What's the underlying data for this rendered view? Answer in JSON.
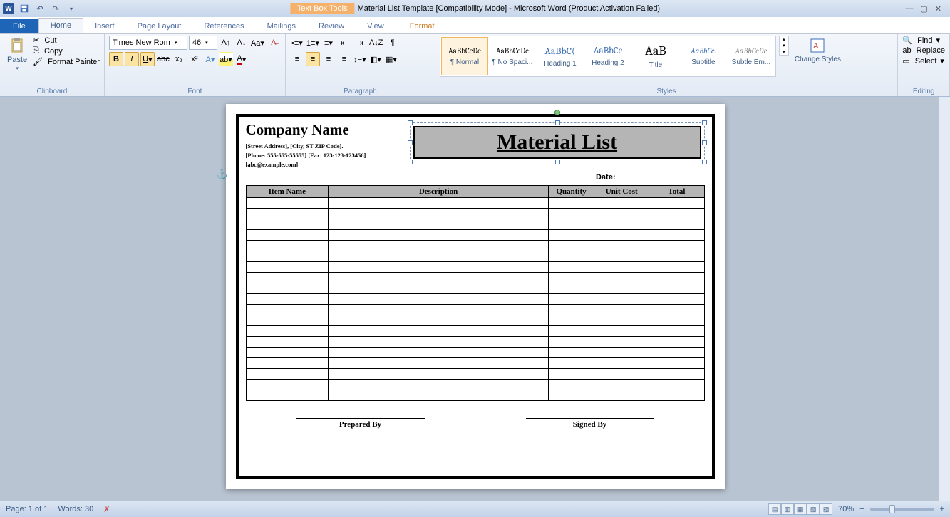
{
  "title": {
    "context_tab": "Text Box Tools",
    "doc": "Material List Template [Compatibility Mode]  -  Microsoft Word (Product Activation Failed)"
  },
  "tabs": {
    "file": "File",
    "home": "Home",
    "insert": "Insert",
    "pagelayout": "Page Layout",
    "references": "References",
    "mailings": "Mailings",
    "review": "Review",
    "view": "View",
    "format": "Format"
  },
  "clipboard": {
    "paste": "Paste",
    "cut": "Cut",
    "copy": "Copy",
    "painter": "Format Painter",
    "label": "Clipboard"
  },
  "font": {
    "name": "Times New Rom",
    "size": "46",
    "label": "Font"
  },
  "paragraph": {
    "label": "Paragraph"
  },
  "styles": {
    "label": "Styles",
    "items": [
      {
        "preview": "AaBbCcDc",
        "name": "¶ Normal"
      },
      {
        "preview": "AaBbCcDc",
        "name": "¶ No Spaci..."
      },
      {
        "preview": "AaBbC(",
        "name": "Heading 1"
      },
      {
        "preview": "AaBbCc",
        "name": "Heading 2"
      },
      {
        "preview": "AaB",
        "name": "Title"
      },
      {
        "preview": "AaBbCc.",
        "name": "Subtitle"
      },
      {
        "preview": "AaBbCcDc",
        "name": "Subtle Em..."
      }
    ],
    "change": "Change Styles"
  },
  "editing": {
    "find": "Find",
    "replace": "Replace",
    "select": "Select",
    "label": "Editing"
  },
  "document": {
    "company": "Company Name",
    "addr": "[Street Address], [City, ST ZIP Code].",
    "phone": "[Phone: 555-555-55555] [Fax: 123-123-123456]",
    "email": "[abc@example.com]",
    "title_box": "Material List",
    "date_label": "Date:",
    "cols": {
      "item": "Item Name",
      "desc": "Description",
      "qty": "Quantity",
      "cost": "Unit Cost",
      "total": "Total"
    },
    "prepared": "Prepared  By",
    "signed": "Signed By"
  },
  "status": {
    "page": "Page: 1 of 1",
    "words": "Words: 30",
    "zoom": "70%"
  }
}
